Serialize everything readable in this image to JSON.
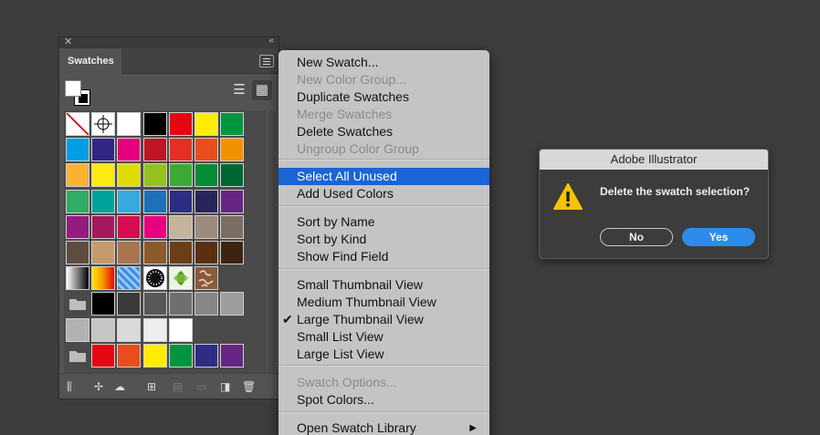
{
  "panel": {
    "close_glyph": "✕",
    "collapse_glyph": "‹‹",
    "tab_label": "Swatches",
    "view_list_icon": "☰",
    "view_grid_icon": "▦",
    "swatch_rows": [
      [
        "none",
        "registration",
        "#ffffff",
        "#000000",
        "#e30613",
        "#ffed00",
        "#009640"
      ],
      [
        "#009fe3",
        "#312783",
        "#e6007e",
        "#be1622",
        "#e42f25",
        "#e84e1b",
        "#f39200"
      ],
      [
        "#f9b233",
        "#fcea10",
        "#dedc00",
        "#95c11f",
        "#3aaa35",
        "#008d36",
        "#006633"
      ],
      [
        "#2fac66",
        "#00a19a",
        "#36a9e1",
        "#1d71b8",
        "#2d2e83",
        "#29235c",
        "#662483"
      ],
      [
        "#951b81",
        "#a3195b",
        "#d60b52",
        "#e6007e",
        "#c5b39d",
        "#9c8b7d",
        "#7c6d62"
      ],
      [
        "#5f4c41",
        "#c49a6c",
        "#a9744f",
        "#8b5a2b",
        "#6b3e17",
        "#5a3010",
        "#3e2410"
      ],
      [
        "grad-gray",
        "grad-orange",
        "grad-blue",
        "pattern-dots",
        "pattern-leaf",
        "pattern-swirl"
      ],
      [
        "folder",
        "#000000",
        "#3a3a3a",
        "#575756",
        "#706f6f",
        "#878787",
        "#9d9d9c"
      ],
      [
        "#b2b2b2",
        "#c6c6c6",
        "#dadada",
        "#ededed",
        "#ffffff"
      ],
      [
        "folder",
        "#e30613",
        "#e84e1b",
        "#ffed00",
        "#009640",
        "#2d2e83",
        "#662483"
      ]
    ],
    "bottom_icons": [
      "library-icon",
      "color-themes-icon",
      "cloud-libraries-icon",
      "show-kinds-icon",
      "swatch-options-icon",
      "new-color-group-icon",
      "new-swatch-icon",
      "delete-swatch-icon"
    ]
  },
  "menu": {
    "items": [
      {
        "label": "New Swatch...",
        "enabled": true
      },
      {
        "label": "New Color Group...",
        "enabled": false
      },
      {
        "label": "Duplicate Swatches",
        "enabled": true
      },
      {
        "label": "Merge Swatches",
        "enabled": false
      },
      {
        "label": "Delete Swatches",
        "enabled": true
      },
      {
        "label": "Ungroup Color Group",
        "enabled": false
      },
      {
        "label": "Select All Unused",
        "enabled": true,
        "highlighted": true
      },
      {
        "label": "Add Used Colors",
        "enabled": true
      },
      {
        "label": "Sort by Name",
        "enabled": true
      },
      {
        "label": "Sort by Kind",
        "enabled": true
      },
      {
        "label": "Show Find Field",
        "enabled": true
      },
      {
        "label": "Small Thumbnail View",
        "enabled": true
      },
      {
        "label": "Medium Thumbnail View",
        "enabled": true
      },
      {
        "label": "Large Thumbnail View",
        "enabled": true,
        "checked": true
      },
      {
        "label": "Small List View",
        "enabled": true
      },
      {
        "label": "Large List View",
        "enabled": true
      },
      {
        "label": "Swatch Options...",
        "enabled": false
      },
      {
        "label": "Spot Colors...",
        "enabled": true
      },
      {
        "label": "Open Swatch Library",
        "enabled": true,
        "submenu": true
      }
    ],
    "check_glyph": "✔",
    "submenu_glyph": "▶"
  },
  "dialog": {
    "title": "Adobe Illustrator",
    "message": "Delete the swatch selection?",
    "no_label": "No",
    "yes_label": "Yes",
    "warning_icon": "warning-icon",
    "accent": "#2d8ceb",
    "warning_color": "#f5c400"
  },
  "colors": {
    "background": "#3d3d3d",
    "panel": "#535353",
    "menu_bg": "#c4c4c4",
    "menu_highlight": "#1a64d6"
  }
}
